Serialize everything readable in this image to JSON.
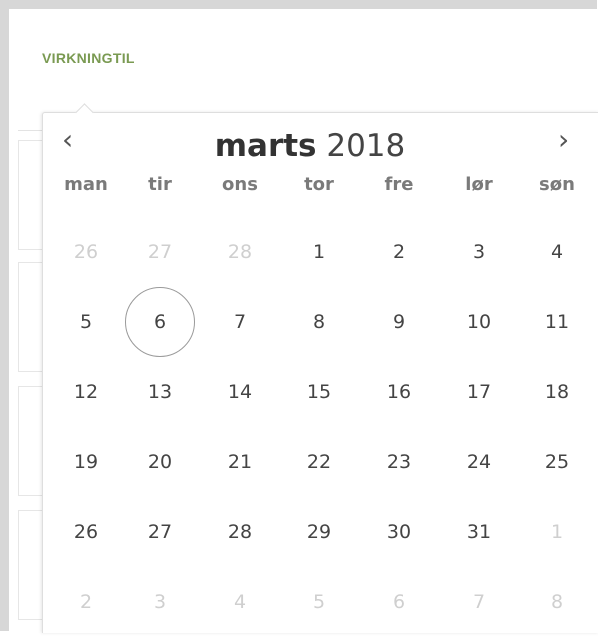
{
  "panel": {
    "label": "VIRKNINGTIL"
  },
  "calendar": {
    "month": "marts",
    "year": "2018",
    "prev_glyph": "‹",
    "next_glyph": "›",
    "weekdays": [
      "man",
      "tir",
      "ons",
      "tor",
      "fre",
      "lør",
      "søn"
    ],
    "weeks": [
      [
        {
          "d": "26",
          "muted": true
        },
        {
          "d": "27",
          "muted": true
        },
        {
          "d": "28",
          "muted": true
        },
        {
          "d": "1"
        },
        {
          "d": "2"
        },
        {
          "d": "3"
        },
        {
          "d": "4"
        }
      ],
      [
        {
          "d": "5"
        },
        {
          "d": "6",
          "today": true
        },
        {
          "d": "7"
        },
        {
          "d": "8"
        },
        {
          "d": "9"
        },
        {
          "d": "10"
        },
        {
          "d": "11"
        }
      ],
      [
        {
          "d": "12"
        },
        {
          "d": "13"
        },
        {
          "d": "14"
        },
        {
          "d": "15"
        },
        {
          "d": "16"
        },
        {
          "d": "17"
        },
        {
          "d": "18"
        }
      ],
      [
        {
          "d": "19"
        },
        {
          "d": "20"
        },
        {
          "d": "21"
        },
        {
          "d": "22"
        },
        {
          "d": "23"
        },
        {
          "d": "24"
        },
        {
          "d": "25"
        }
      ],
      [
        {
          "d": "26"
        },
        {
          "d": "27"
        },
        {
          "d": "28"
        },
        {
          "d": "29"
        },
        {
          "d": "30"
        },
        {
          "d": "31"
        },
        {
          "d": "1",
          "muted": true
        }
      ],
      [
        {
          "d": "2",
          "muted": true
        },
        {
          "d": "3",
          "muted": true
        },
        {
          "d": "4",
          "muted": true
        },
        {
          "d": "5",
          "muted": true
        },
        {
          "d": "6",
          "muted": true
        },
        {
          "d": "7",
          "muted": true
        },
        {
          "d": "8",
          "muted": true
        }
      ]
    ]
  },
  "colors": {
    "label_green": "#7a9a52",
    "muted_day": "#cfcfcf",
    "day_text": "#444444"
  }
}
